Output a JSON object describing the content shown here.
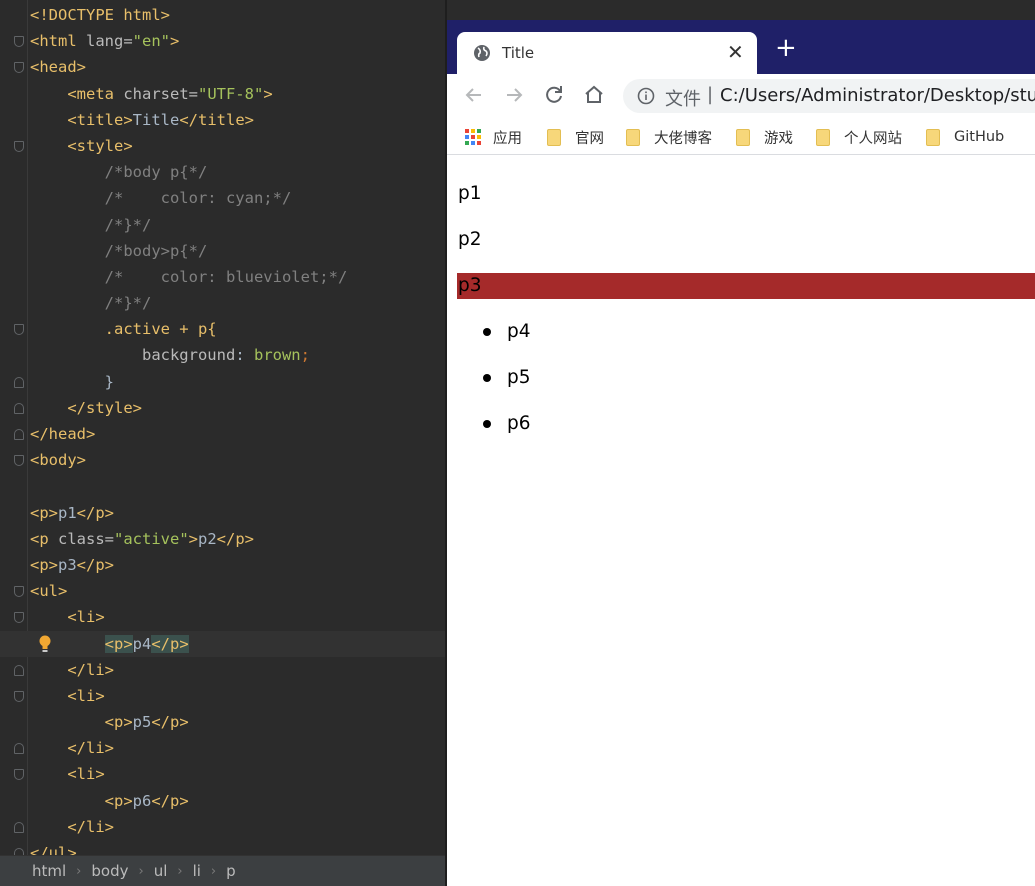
{
  "editor": {
    "lines": [
      {
        "fold": "",
        "parts": [
          [
            "tag",
            "<!DOCTYPE html>"
          ]
        ]
      },
      {
        "fold": "down",
        "parts": [
          [
            "tag",
            "<html "
          ],
          [
            "attr",
            "lang="
          ],
          [
            "val",
            "\"en\""
          ],
          [
            "tag",
            ">"
          ]
        ]
      },
      {
        "fold": "down",
        "parts": [
          [
            "tag",
            "<head>"
          ]
        ]
      },
      {
        "fold": "",
        "parts": [
          [
            "",
            "    "
          ],
          [
            "tag",
            "<meta "
          ],
          [
            "attr",
            "charset="
          ],
          [
            "val",
            "\"UTF-8\""
          ],
          [
            "tag",
            ">"
          ]
        ]
      },
      {
        "fold": "",
        "parts": [
          [
            "",
            "    "
          ],
          [
            "tag",
            "<title>"
          ],
          [
            "",
            "Title"
          ],
          [
            "tag",
            "</title>"
          ]
        ]
      },
      {
        "fold": "down",
        "parts": [
          [
            "",
            "    "
          ],
          [
            "tag",
            "<style>"
          ]
        ]
      },
      {
        "fold": "",
        "parts": [
          [
            "",
            "        "
          ],
          [
            "cmt",
            "/*body p{*/"
          ]
        ]
      },
      {
        "fold": "",
        "parts": [
          [
            "",
            "        "
          ],
          [
            "cmt",
            "/*    color: cyan;*/"
          ]
        ]
      },
      {
        "fold": "",
        "parts": [
          [
            "",
            "        "
          ],
          [
            "cmt",
            "/*}*/"
          ]
        ]
      },
      {
        "fold": "",
        "parts": [
          [
            "",
            "        "
          ],
          [
            "cmt",
            "/*body>p{*/"
          ]
        ]
      },
      {
        "fold": "",
        "parts": [
          [
            "",
            "        "
          ],
          [
            "cmt",
            "/*    color: blueviolet;*/"
          ]
        ]
      },
      {
        "fold": "",
        "parts": [
          [
            "",
            "        "
          ],
          [
            "cmt",
            "/*}*/"
          ]
        ]
      },
      {
        "fold": "down",
        "parts": [
          [
            "",
            "        "
          ],
          [
            "sel",
            ".active + p{"
          ]
        ]
      },
      {
        "fold": "",
        "parts": [
          [
            "",
            "            "
          ],
          [
            "prop",
            "background"
          ],
          [
            "",
            ": "
          ],
          [
            "kw",
            "brown"
          ],
          [
            "semi",
            ";"
          ]
        ]
      },
      {
        "fold": "up",
        "parts": [
          [
            "",
            "        "
          ],
          [
            "",
            "}"
          ]
        ]
      },
      {
        "fold": "up",
        "parts": [
          [
            "",
            "    "
          ],
          [
            "tag",
            "</style>"
          ]
        ]
      },
      {
        "fold": "up",
        "parts": [
          [
            "tag",
            "</head>"
          ]
        ]
      },
      {
        "fold": "down",
        "parts": [
          [
            "tag",
            "<body>"
          ]
        ]
      },
      {
        "fold": "",
        "parts": []
      },
      {
        "fold": "",
        "parts": [
          [
            "tag",
            "<p>"
          ],
          [
            "",
            "p1"
          ],
          [
            "tag",
            "</p>"
          ]
        ]
      },
      {
        "fold": "",
        "parts": [
          [
            "tag",
            "<p "
          ],
          [
            "attr",
            "class="
          ],
          [
            "val",
            "\"active\""
          ],
          [
            "tag",
            ">"
          ],
          [
            "",
            "p2"
          ],
          [
            "tag",
            "</p>"
          ]
        ]
      },
      {
        "fold": "",
        "parts": [
          [
            "tag",
            "<p>"
          ],
          [
            "",
            "p3"
          ],
          [
            "tag",
            "</p>"
          ]
        ]
      },
      {
        "fold": "down",
        "parts": [
          [
            "tag",
            "<ul>"
          ]
        ]
      },
      {
        "fold": "down",
        "parts": [
          [
            "",
            "    "
          ],
          [
            "tag",
            "<li>"
          ]
        ]
      },
      {
        "fold": "",
        "current": true,
        "parts": [
          [
            "",
            "        "
          ],
          [
            "tag hl",
            "<p>"
          ],
          [
            "",
            "p4"
          ],
          [
            "tag hl",
            "</p>"
          ]
        ]
      },
      {
        "fold": "up",
        "parts": [
          [
            "",
            "    "
          ],
          [
            "tag",
            "</li>"
          ]
        ]
      },
      {
        "fold": "down",
        "parts": [
          [
            "",
            "    "
          ],
          [
            "tag",
            "<li>"
          ]
        ]
      },
      {
        "fold": "",
        "parts": [
          [
            "",
            "        "
          ],
          [
            "tag",
            "<p>"
          ],
          [
            "",
            "p5"
          ],
          [
            "tag",
            "</p>"
          ]
        ]
      },
      {
        "fold": "up",
        "parts": [
          [
            "",
            "    "
          ],
          [
            "tag",
            "</li>"
          ]
        ]
      },
      {
        "fold": "down",
        "parts": [
          [
            "",
            "    "
          ],
          [
            "tag",
            "<li>"
          ]
        ]
      },
      {
        "fold": "",
        "parts": [
          [
            "",
            "        "
          ],
          [
            "tag",
            "<p>"
          ],
          [
            "",
            "p6"
          ],
          [
            "tag",
            "</p>"
          ]
        ]
      },
      {
        "fold": "up",
        "parts": [
          [
            "",
            "    "
          ],
          [
            "tag",
            "</li>"
          ]
        ]
      },
      {
        "fold": "up",
        "parts": [
          [
            "tag",
            "</ul>"
          ]
        ]
      }
    ],
    "breadcrumbs": [
      "html",
      "body",
      "ul",
      "li",
      "p"
    ]
  },
  "browser": {
    "tab_title": "Title",
    "tab_close": "✕",
    "new_tab": "+",
    "address": {
      "file_label": "文件",
      "separator": "|",
      "url": "C:/Users/Administrator/Desktop/stud"
    },
    "bookmarks": [
      {
        "label": "应用",
        "icon": "apps-icon"
      },
      {
        "label": "官网",
        "icon": "folder-icon"
      },
      {
        "label": "大佬博客",
        "icon": "folder-icon"
      },
      {
        "label": "游戏",
        "icon": "folder-icon"
      },
      {
        "label": "个人网站",
        "icon": "folder-icon"
      },
      {
        "label": "GitHub",
        "icon": "folder-icon"
      }
    ],
    "page": {
      "paragraphs": [
        "p1",
        "p2",
        "p3"
      ],
      "list_items": [
        "p4",
        "p5",
        "p6"
      ],
      "highlight_color": "#a52a2a"
    }
  },
  "colors": {
    "editor_bg": "#2b2b2b",
    "tab_bar_bg": "#1f2068",
    "tag": "#e8bf6a",
    "string": "#a5c25c",
    "comment": "#808080"
  }
}
